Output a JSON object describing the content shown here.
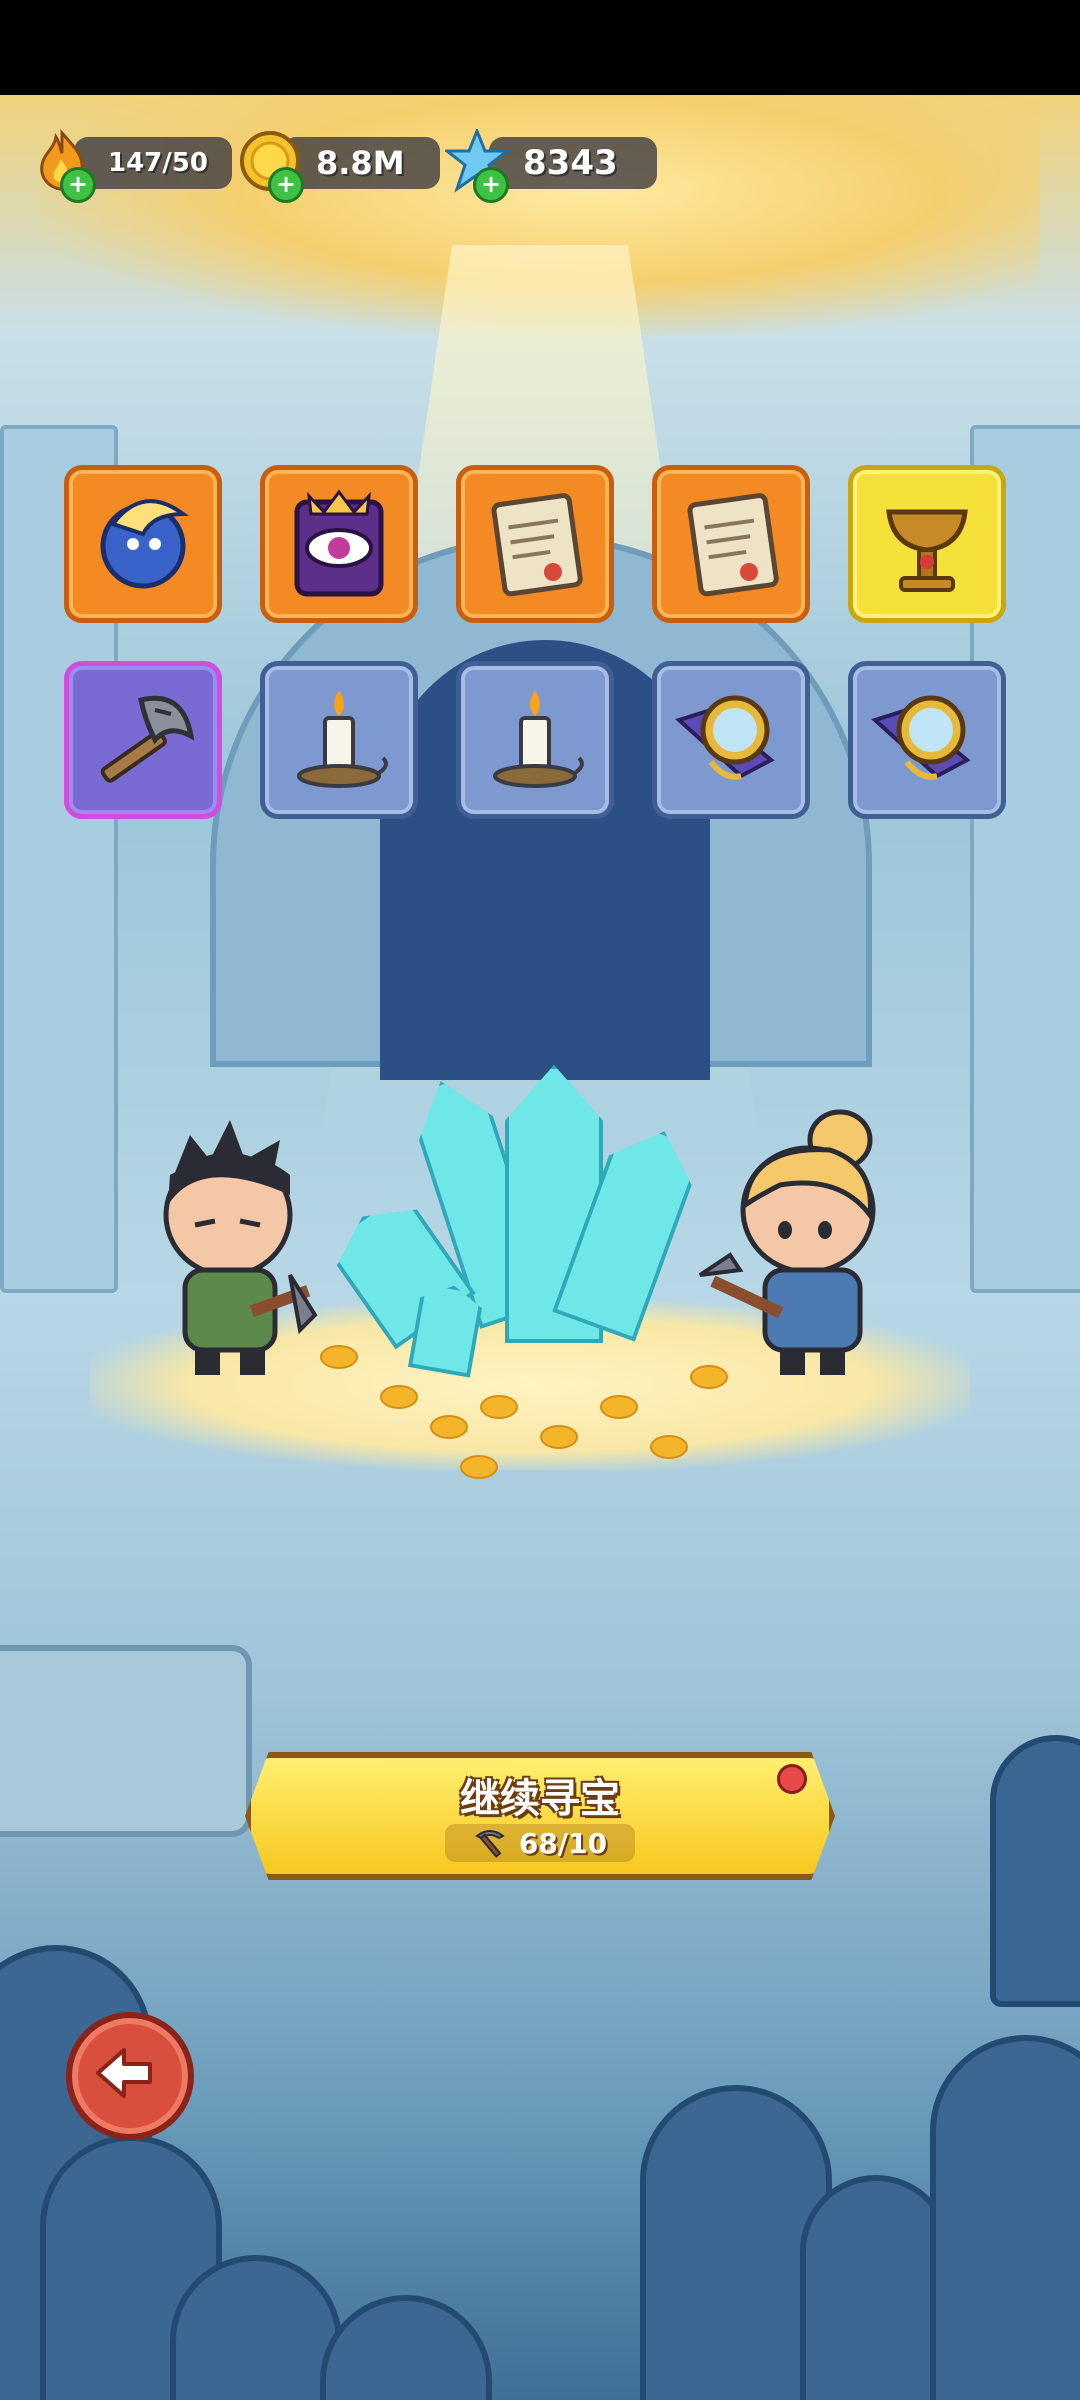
{
  "hud": {
    "energy": {
      "icon": "flame-icon",
      "value": "147/50"
    },
    "coins": {
      "icon": "gold-coin-icon",
      "value": "8.8M"
    },
    "gems": {
      "icon": "blue-crystal-icon",
      "value": "8343"
    }
  },
  "inventory": {
    "row1": [
      {
        "name": "spirit-orb-icon",
        "rarity": "orange"
      },
      {
        "name": "eye-tome-icon",
        "rarity": "orange"
      },
      {
        "name": "scroll-icon",
        "rarity": "orange"
      },
      {
        "name": "scroll-icon",
        "rarity": "orange"
      },
      {
        "name": "chalice-icon",
        "rarity": "gold"
      }
    ],
    "row2": [
      {
        "name": "axe-icon",
        "rarity": "purple"
      },
      {
        "name": "candle-icon",
        "rarity": "blue"
      },
      {
        "name": "candle-icon",
        "rarity": "blue"
      },
      {
        "name": "pocket-mirror-icon",
        "rarity": "blue"
      },
      {
        "name": "pocket-mirror-icon",
        "rarity": "blue"
      }
    ]
  },
  "action": {
    "title": "继续寻宝",
    "counter_icon": "pickaxe-icon",
    "counter": "68/10"
  },
  "colors": {
    "cta": "#f7c81f",
    "orange_slot": "#f48a23",
    "gold_slot": "#f5e13a",
    "purple_slot": "#d04de0",
    "blue_slot": "#7d99cf"
  }
}
